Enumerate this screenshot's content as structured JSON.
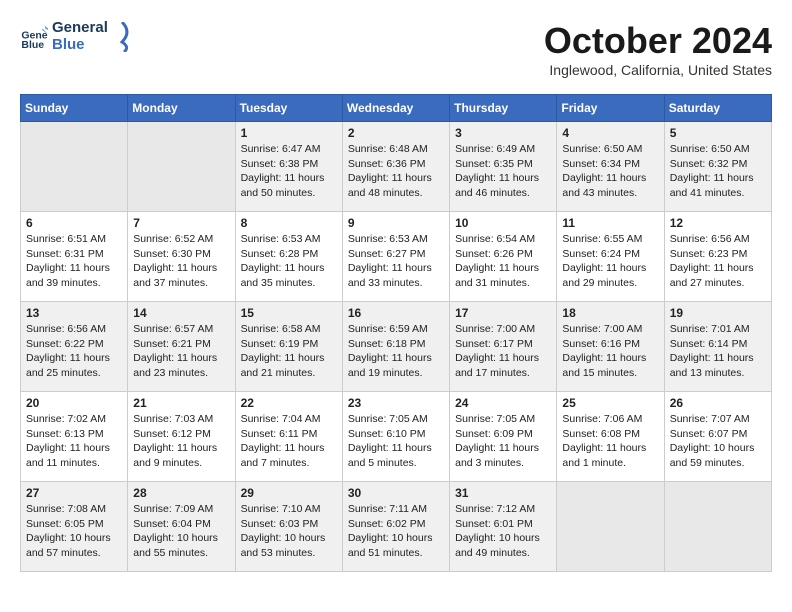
{
  "header": {
    "logo_line1": "General",
    "logo_line2": "Blue",
    "month": "October 2024",
    "location": "Inglewood, California, United States"
  },
  "weekdays": [
    "Sunday",
    "Monday",
    "Tuesday",
    "Wednesday",
    "Thursday",
    "Friday",
    "Saturday"
  ],
  "weeks": [
    [
      {
        "day": "",
        "empty": true
      },
      {
        "day": "",
        "empty": true
      },
      {
        "day": "1",
        "sunrise": "6:47 AM",
        "sunset": "6:38 PM",
        "daylight": "11 hours and 50 minutes."
      },
      {
        "day": "2",
        "sunrise": "6:48 AM",
        "sunset": "6:36 PM",
        "daylight": "11 hours and 48 minutes."
      },
      {
        "day": "3",
        "sunrise": "6:49 AM",
        "sunset": "6:35 PM",
        "daylight": "11 hours and 46 minutes."
      },
      {
        "day": "4",
        "sunrise": "6:50 AM",
        "sunset": "6:34 PM",
        "daylight": "11 hours and 43 minutes."
      },
      {
        "day": "5",
        "sunrise": "6:50 AM",
        "sunset": "6:32 PM",
        "daylight": "11 hours and 41 minutes."
      }
    ],
    [
      {
        "day": "6",
        "sunrise": "6:51 AM",
        "sunset": "6:31 PM",
        "daylight": "11 hours and 39 minutes."
      },
      {
        "day": "7",
        "sunrise": "6:52 AM",
        "sunset": "6:30 PM",
        "daylight": "11 hours and 37 minutes."
      },
      {
        "day": "8",
        "sunrise": "6:53 AM",
        "sunset": "6:28 PM",
        "daylight": "11 hours and 35 minutes."
      },
      {
        "day": "9",
        "sunrise": "6:53 AM",
        "sunset": "6:27 PM",
        "daylight": "11 hours and 33 minutes."
      },
      {
        "day": "10",
        "sunrise": "6:54 AM",
        "sunset": "6:26 PM",
        "daylight": "11 hours and 31 minutes."
      },
      {
        "day": "11",
        "sunrise": "6:55 AM",
        "sunset": "6:24 PM",
        "daylight": "11 hours and 29 minutes."
      },
      {
        "day": "12",
        "sunrise": "6:56 AM",
        "sunset": "6:23 PM",
        "daylight": "11 hours and 27 minutes."
      }
    ],
    [
      {
        "day": "13",
        "sunrise": "6:56 AM",
        "sunset": "6:22 PM",
        "daylight": "11 hours and 25 minutes."
      },
      {
        "day": "14",
        "sunrise": "6:57 AM",
        "sunset": "6:21 PM",
        "daylight": "11 hours and 23 minutes."
      },
      {
        "day": "15",
        "sunrise": "6:58 AM",
        "sunset": "6:19 PM",
        "daylight": "11 hours and 21 minutes."
      },
      {
        "day": "16",
        "sunrise": "6:59 AM",
        "sunset": "6:18 PM",
        "daylight": "11 hours and 19 minutes."
      },
      {
        "day": "17",
        "sunrise": "7:00 AM",
        "sunset": "6:17 PM",
        "daylight": "11 hours and 17 minutes."
      },
      {
        "day": "18",
        "sunrise": "7:00 AM",
        "sunset": "6:16 PM",
        "daylight": "11 hours and 15 minutes."
      },
      {
        "day": "19",
        "sunrise": "7:01 AM",
        "sunset": "6:14 PM",
        "daylight": "11 hours and 13 minutes."
      }
    ],
    [
      {
        "day": "20",
        "sunrise": "7:02 AM",
        "sunset": "6:13 PM",
        "daylight": "11 hours and 11 minutes."
      },
      {
        "day": "21",
        "sunrise": "7:03 AM",
        "sunset": "6:12 PM",
        "daylight": "11 hours and 9 minutes."
      },
      {
        "day": "22",
        "sunrise": "7:04 AM",
        "sunset": "6:11 PM",
        "daylight": "11 hours and 7 minutes."
      },
      {
        "day": "23",
        "sunrise": "7:05 AM",
        "sunset": "6:10 PM",
        "daylight": "11 hours and 5 minutes."
      },
      {
        "day": "24",
        "sunrise": "7:05 AM",
        "sunset": "6:09 PM",
        "daylight": "11 hours and 3 minutes."
      },
      {
        "day": "25",
        "sunrise": "7:06 AM",
        "sunset": "6:08 PM",
        "daylight": "11 hours and 1 minute."
      },
      {
        "day": "26",
        "sunrise": "7:07 AM",
        "sunset": "6:07 PM",
        "daylight": "10 hours and 59 minutes."
      }
    ],
    [
      {
        "day": "27",
        "sunrise": "7:08 AM",
        "sunset": "6:05 PM",
        "daylight": "10 hours and 57 minutes."
      },
      {
        "day": "28",
        "sunrise": "7:09 AM",
        "sunset": "6:04 PM",
        "daylight": "10 hours and 55 minutes."
      },
      {
        "day": "29",
        "sunrise": "7:10 AM",
        "sunset": "6:03 PM",
        "daylight": "10 hours and 53 minutes."
      },
      {
        "day": "30",
        "sunrise": "7:11 AM",
        "sunset": "6:02 PM",
        "daylight": "10 hours and 51 minutes."
      },
      {
        "day": "31",
        "sunrise": "7:12 AM",
        "sunset": "6:01 PM",
        "daylight": "10 hours and 49 minutes."
      },
      {
        "day": "",
        "empty": true
      },
      {
        "day": "",
        "empty": true
      }
    ]
  ]
}
